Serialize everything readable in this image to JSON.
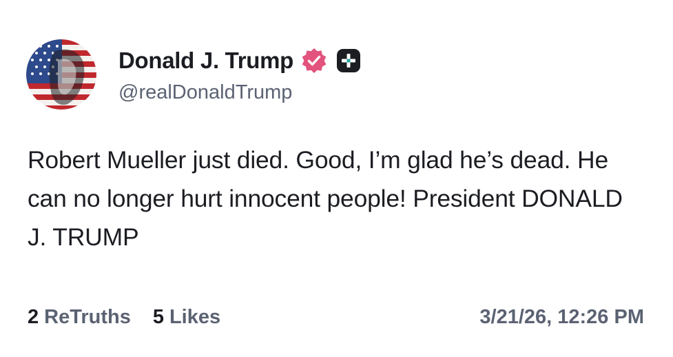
{
  "author": {
    "display_name": "Donald J. Trump",
    "handle": "@realDonaldTrump",
    "avatar_icon": "flag-portrait-avatar",
    "verified_icon": "verified-badge-icon",
    "verified_color": "#e2537d",
    "plus_icon": "plus-badge-icon"
  },
  "post": {
    "text": "Robert Mueller just died. Good, I’m glad he’s dead. He can no longer hurt innocent people! President DONALD J. TRUMP"
  },
  "stats": {
    "retruths_count": "2",
    "retruths_label": "ReTruths",
    "likes_count": "5",
    "likes_label": "Likes"
  },
  "timestamp": "3/21/26, 12:26 PM"
}
